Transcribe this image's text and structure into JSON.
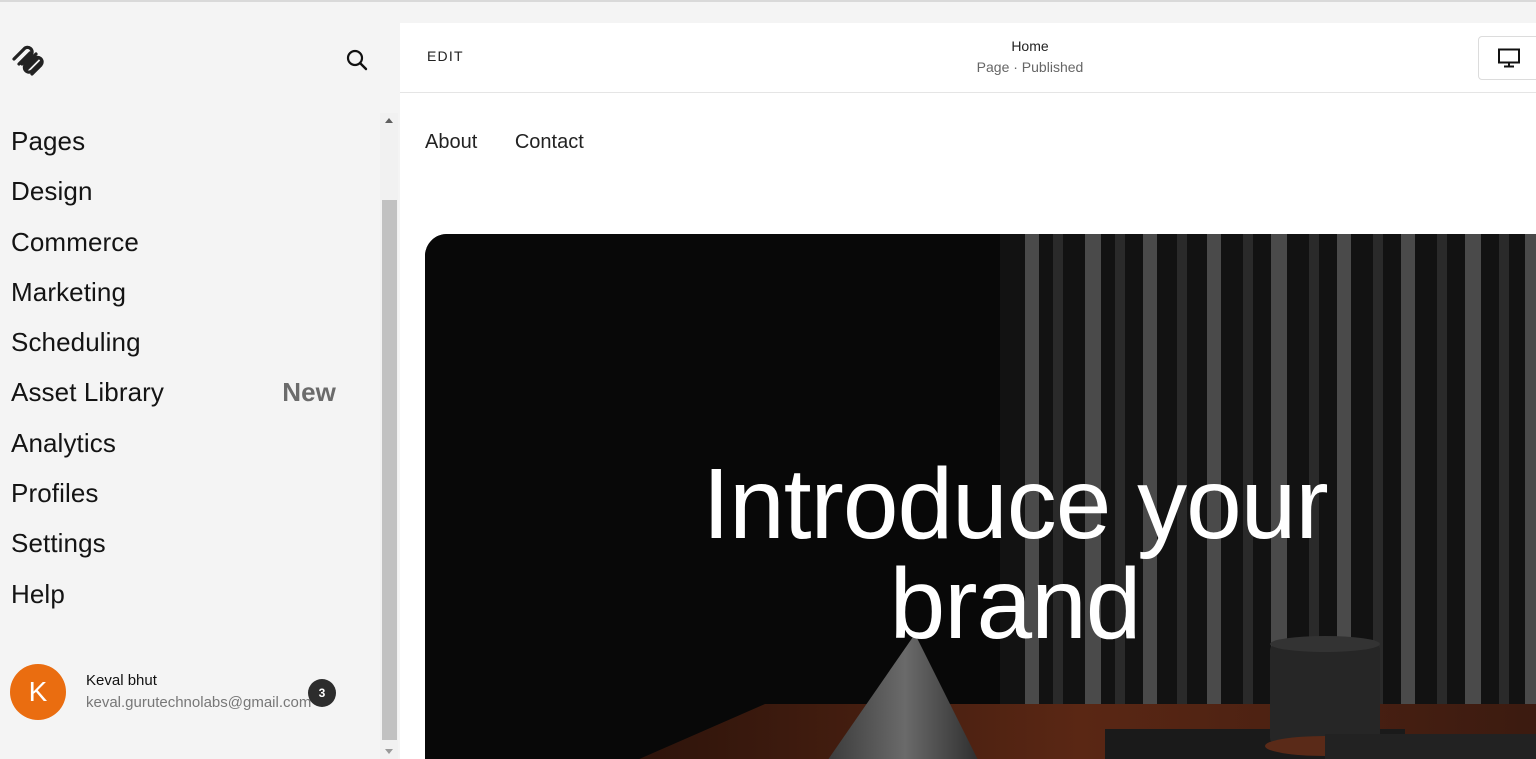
{
  "sidebar": {
    "logo_icon": "squarespace-logo-icon",
    "search_icon": "search-icon",
    "nav_items": [
      {
        "label": "Pages"
      },
      {
        "label": "Design"
      },
      {
        "label": "Commerce"
      },
      {
        "label": "Marketing"
      },
      {
        "label": "Scheduling"
      },
      {
        "label": "Asset Library",
        "badge": "New"
      },
      {
        "label": "Analytics"
      },
      {
        "label": "Profiles"
      },
      {
        "label": "Settings"
      },
      {
        "label": "Help"
      }
    ],
    "user": {
      "initial": "K",
      "name": "Keval bhut",
      "email": "keval.gurutechnolabs@gmail.com",
      "notifications": "3",
      "avatar_color": "#ea6d10"
    }
  },
  "editor": {
    "edit_label": "EDIT",
    "page_title": "Home",
    "page_status": "Page · Published",
    "device_icon": "desktop-monitor-icon"
  },
  "site": {
    "nav": [
      "About",
      "Contact"
    ],
    "hero_title_line1": "Introduce your",
    "hero_title_line2": "brand"
  }
}
